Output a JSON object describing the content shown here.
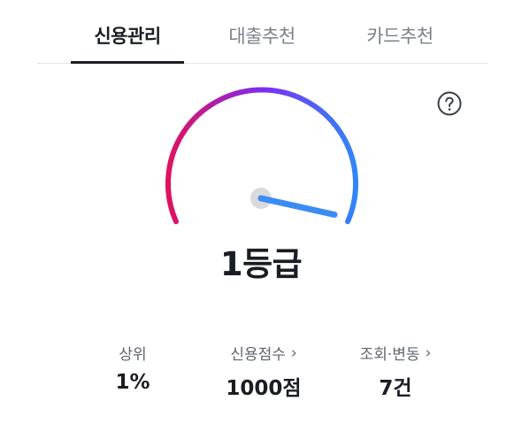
{
  "tabs": [
    {
      "label": "신용관리",
      "active": true
    },
    {
      "label": "대출추천",
      "active": false
    },
    {
      "label": "카드추천",
      "active": false
    }
  ],
  "gauge": {
    "level_fraction": 0.95,
    "gradient_colors": [
      "#e0115f",
      "#7e2cf3",
      "#2f86f6"
    ],
    "needle_color": "#3b8cf2",
    "hub_color": "#d9dadd"
  },
  "grade": "1등급",
  "stats": [
    {
      "label": "상위",
      "value": "1%",
      "chevron": ""
    },
    {
      "label": "신용점수",
      "value": "1000점",
      "chevron": "›"
    },
    {
      "label": "조회·변동",
      "value": "7건",
      "chevron": "›"
    }
  ],
  "icons": {
    "help": "question-circle-icon",
    "chevron": "chevron-right-icon"
  }
}
